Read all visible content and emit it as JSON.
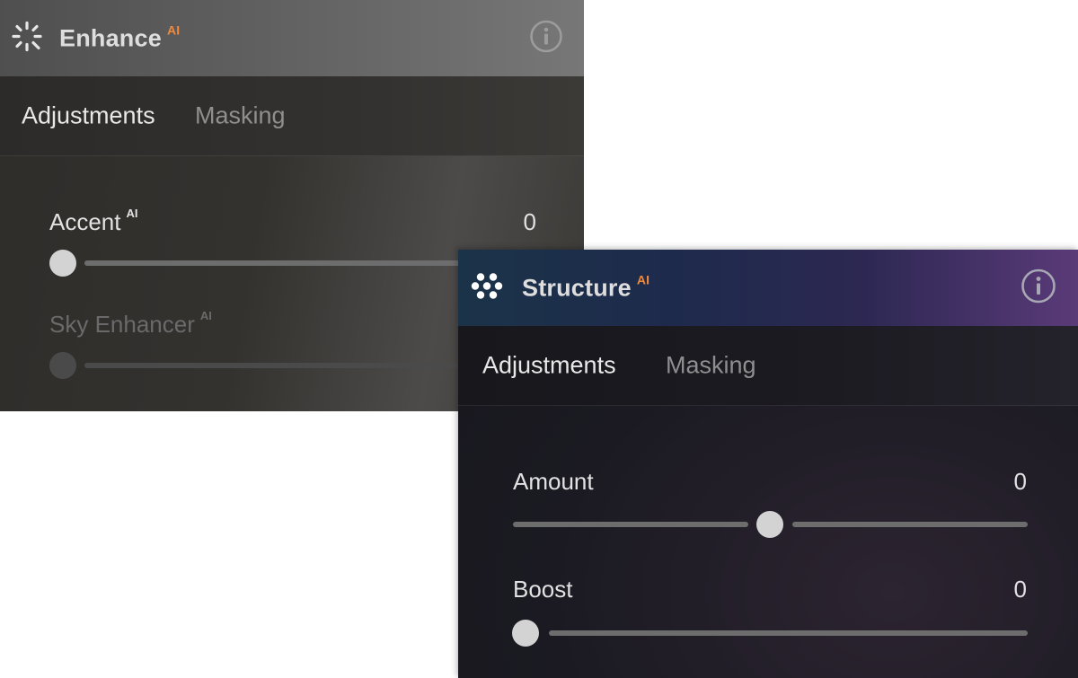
{
  "enhance_panel": {
    "title": "Enhance",
    "ai_badge": "AI",
    "header_icon": "sparkle-burst-icon",
    "info_icon": "info-circle-icon",
    "tabs": [
      {
        "label": "Adjustments",
        "active": true
      },
      {
        "label": "Masking",
        "active": false
      }
    ],
    "sliders": [
      {
        "label": "Accent",
        "ai": "AI",
        "value": "0",
        "position": 0.0,
        "enabled": true
      },
      {
        "label": "Sky Enhancer",
        "ai": "AI",
        "value": "",
        "position": 0.0,
        "enabled": false
      }
    ]
  },
  "structure_panel": {
    "title": "Structure",
    "ai_badge": "AI",
    "header_icon": "dots-cluster-icon",
    "info_icon": "info-circle-icon",
    "tabs": [
      {
        "label": "Adjustments",
        "active": true
      },
      {
        "label": "Masking",
        "active": false
      }
    ],
    "sliders": [
      {
        "label": "Amount",
        "value": "0",
        "position": 0.5,
        "enabled": true
      },
      {
        "label": "Boost",
        "value": "0",
        "position": 0.0,
        "enabled": true
      }
    ]
  },
  "colors": {
    "ai_accent": "#f08a3c",
    "slider_thumb": "#d3d3d3",
    "slider_track": "#6d6d6d"
  }
}
